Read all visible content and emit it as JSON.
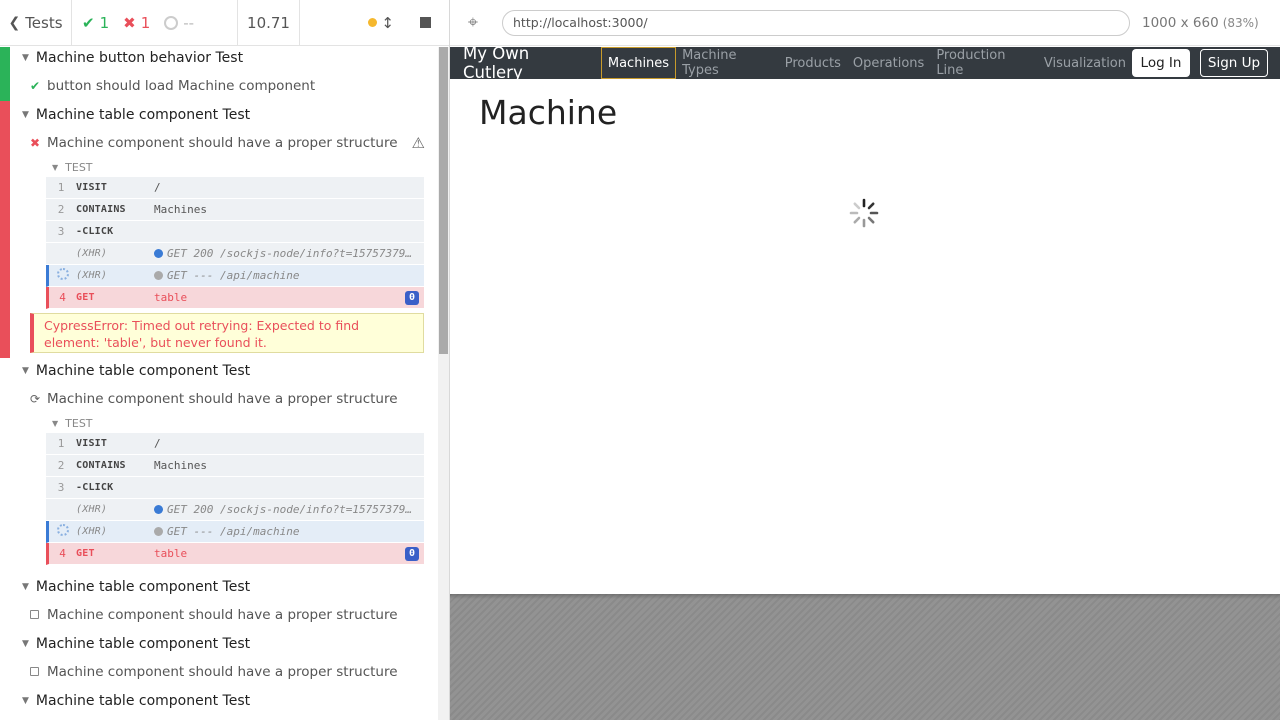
{
  "stats": {
    "tests_label": "Tests",
    "passed": "1",
    "failed": "1",
    "pending": "--",
    "duration": "10.71"
  },
  "aut": {
    "url": "http://localhost:3000/",
    "viewport": "1000 x 660",
    "scale": "(83%)",
    "app": {
      "brand": "My Own Cutlery",
      "nav": [
        "Machines",
        "Machine Types",
        "Products",
        "Operations",
        "Production Line",
        "Visualization"
      ],
      "login": "Log In",
      "signup": "Sign Up",
      "heading": "Machine"
    }
  },
  "reporter": {
    "suites": [
      {
        "title": "Machine button behavior Test",
        "test": "button should load Machine component",
        "state": "passed"
      },
      {
        "title": "Machine table component Test",
        "test": "Machine component should have a proper structure",
        "state": "failed"
      },
      {
        "title": "Machine table component Test",
        "test": "Machine component should have a proper structure",
        "state": "running"
      },
      {
        "title": "Machine table component Test",
        "test": "Machine component should have a proper structure",
        "state": "pending"
      },
      {
        "title": "Machine table component Test",
        "test": "Machine component should have a proper structure",
        "state": "pending"
      },
      {
        "title": "Machine table component Test"
      }
    ],
    "hook_label": "TEST",
    "commands": [
      {
        "num": "1",
        "name": "VISIT",
        "msg": "/"
      },
      {
        "num": "2",
        "name": "CONTAINS",
        "msg": "Machines"
      },
      {
        "num": "3",
        "name": "-CLICK",
        "msg": ""
      },
      {
        "num": "",
        "name": "(XHR)",
        "msg": "GET 200 /sockjs-node/info?t=15757379..."
      },
      {
        "num": "",
        "name": "(XHR)",
        "msg": "GET --- /api/machine"
      },
      {
        "num": "4",
        "name": "GET",
        "msg": "table",
        "badge": "0"
      }
    ],
    "error": "CypressError: Timed out retrying: Expected to find element: 'table', but never found it."
  }
}
